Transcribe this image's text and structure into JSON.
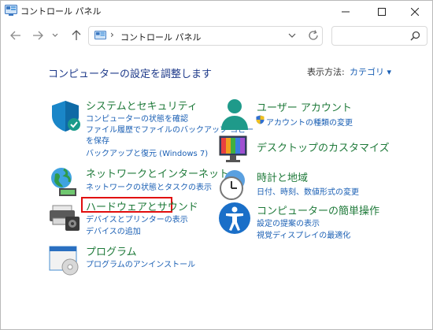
{
  "window": {
    "title": "コントロール パネル"
  },
  "nav": {
    "address_separator": "›",
    "address_text": "コントロール パネル",
    "search_placeholder": ""
  },
  "heading": "コンピューターの設定を調整します",
  "view": {
    "label": "表示方法:",
    "value": "カテゴリ ▾"
  },
  "left_categories": [
    {
      "title": "システムとセキュリティ",
      "links": [
        "コンピューターの状態を確認",
        "ファイル履歴でファイルのバックアップ コピー",
        "を保存",
        "バックアップと復元 (Windows 7)"
      ]
    },
    {
      "title": "ネットワークとインターネット",
      "links": [
        "ネットワークの状態とタスクの表示"
      ]
    },
    {
      "title": "ハードウェアとサウンド",
      "links": [
        "デバイスとプリンターの表示",
        "デバイスの追加"
      ]
    },
    {
      "title": "プログラム",
      "links": [
        "プログラムのアンインストール"
      ]
    }
  ],
  "right_categories": [
    {
      "title": "ユーザー アカウント",
      "links": [
        "アカウントの種類の変更"
      ]
    },
    {
      "title": "デスクトップのカスタマイズ",
      "links": []
    },
    {
      "title": "時計と地域",
      "links": [
        "日付、時刻、数値形式の変更"
      ]
    },
    {
      "title": "コンピューターの簡単操作",
      "links": [
        "設定の提案の表示",
        "視覚ディスプレイの最適化"
      ]
    }
  ],
  "colors": {
    "heading": "#1e3a8a",
    "category_title": "#1f7a3a",
    "link": "#1a5fb4",
    "highlight": "#e10d0d"
  }
}
